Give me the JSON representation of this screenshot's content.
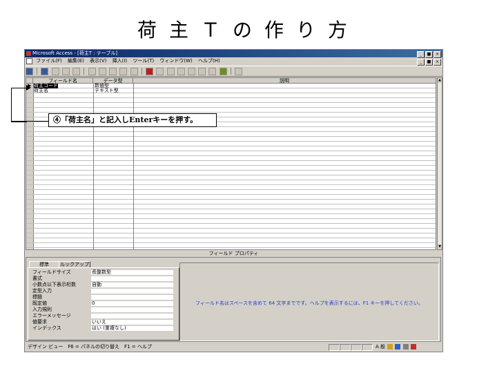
{
  "slide": {
    "title": "荷主Ｔの作り方"
  },
  "window": {
    "title": "Microsoft Access - [荷主T : テーブル]",
    "controls": [
      "_",
      "■",
      "×"
    ]
  },
  "menu": {
    "items": [
      "ファイル(F)",
      "編集(E)",
      "表示(V)",
      "挿入(I)",
      "ツール(T)",
      "ウィンドウ(W)",
      "ヘルプ(H)"
    ]
  },
  "table_grid": {
    "headers": {
      "field_name": "フィールド名",
      "data_type": "データ型",
      "description": "説明"
    },
    "rows": [
      {
        "field_name": "荷主コード",
        "data_type": "数値型"
      },
      {
        "field_name": "荷主名",
        "data_type": "テキスト型"
      }
    ]
  },
  "field_properties": {
    "header": "フィールド プロパティ",
    "tabs": {
      "general": "標準",
      "lookup": "ルックアップ"
    },
    "rows": [
      {
        "label": "フィールドサイズ",
        "value": "長整数型"
      },
      {
        "label": "書式",
        "value": ""
      },
      {
        "label": "小数点以下表示桁数",
        "value": "自動"
      },
      {
        "label": "定型入力",
        "value": ""
      },
      {
        "label": "標題",
        "value": ""
      },
      {
        "label": "既定値",
        "value": "0"
      },
      {
        "label": "入力規則",
        "value": ""
      },
      {
        "label": "エラーメッセージ",
        "value": ""
      },
      {
        "label": "値要求",
        "value": "いいえ"
      },
      {
        "label": "インデックス",
        "value": "はい (重複なし)"
      }
    ],
    "help_text": "フィールド名はスペースを含めて 64 文字までです。ヘルプを表示するには、F1 キーを押してください。"
  },
  "status_bar": {
    "text": "デザイン ビュー　F6 = パネルの切り替え　F1 = ヘルプ",
    "ime": "A 般"
  },
  "callout": {
    "text": "④「荷主名」と記入しEnterキーを押す。"
  },
  "colors": {
    "titlebar_start": "#0a246a",
    "help_text": "#1a3fcc",
    "window_bg": "#d4d0c8"
  }
}
